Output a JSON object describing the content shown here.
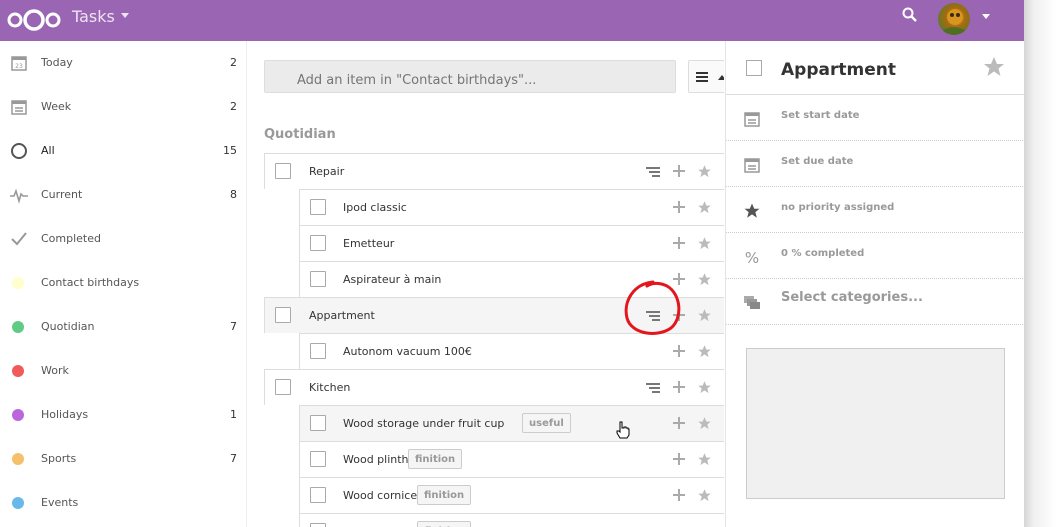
{
  "header": {
    "app_title": "Tasks",
    "logo_icon": "nextcloud-logo-icon",
    "search_icon": "search-icon",
    "color": "#9a66b4"
  },
  "sidebar": {
    "items": [
      {
        "label": "Today",
        "count": "2",
        "icon": "calendar-today-icon"
      },
      {
        "label": "Week",
        "count": "2",
        "icon": "calendar-week-icon"
      },
      {
        "label": "All",
        "count": "15",
        "icon": "circle-icon"
      },
      {
        "label": "Current",
        "count": "8",
        "icon": "pulse-icon"
      },
      {
        "label": "Completed",
        "count": "",
        "icon": "checkmark-icon"
      },
      {
        "label": "Contact birthdays",
        "count": "",
        "color": "#ffffcc"
      },
      {
        "label": "Quotidian",
        "count": "7",
        "color": "#5fcc85"
      },
      {
        "label": "Work",
        "count": "",
        "color": "#f05a5a"
      },
      {
        "label": "Holidays",
        "count": "1",
        "color": "#bb67dc"
      },
      {
        "label": "Sports",
        "count": "7",
        "color": "#f5c06b"
      },
      {
        "label": "Events",
        "count": "",
        "color": "#69b8ec"
      }
    ]
  },
  "main": {
    "add_placeholder": "Add an item in \"Contact birthdays\"...",
    "section_title": "Quotidian",
    "tasks": [
      {
        "label": "Repair"
      },
      {
        "label": "Ipod classic"
      },
      {
        "label": "Emetteur"
      },
      {
        "label": "Aspirateur à main"
      },
      {
        "label": "Appartment"
      },
      {
        "label": "Autonom vacuum 100€"
      },
      {
        "label": "Kitchen"
      },
      {
        "label": "Wood storage under fruit cup",
        "tag": "useful"
      },
      {
        "label": "Wood plinth",
        "tag": "finition"
      },
      {
        "label": "Wood cornice",
        "tag": "finition"
      },
      {
        "label": "",
        "tag": "finition"
      }
    ]
  },
  "details": {
    "title": "Appartment",
    "start_date": "Set start date",
    "due_date": "Set due date",
    "priority": "no priority assigned",
    "completed": "0 % completed",
    "categories": "Select categories..."
  }
}
